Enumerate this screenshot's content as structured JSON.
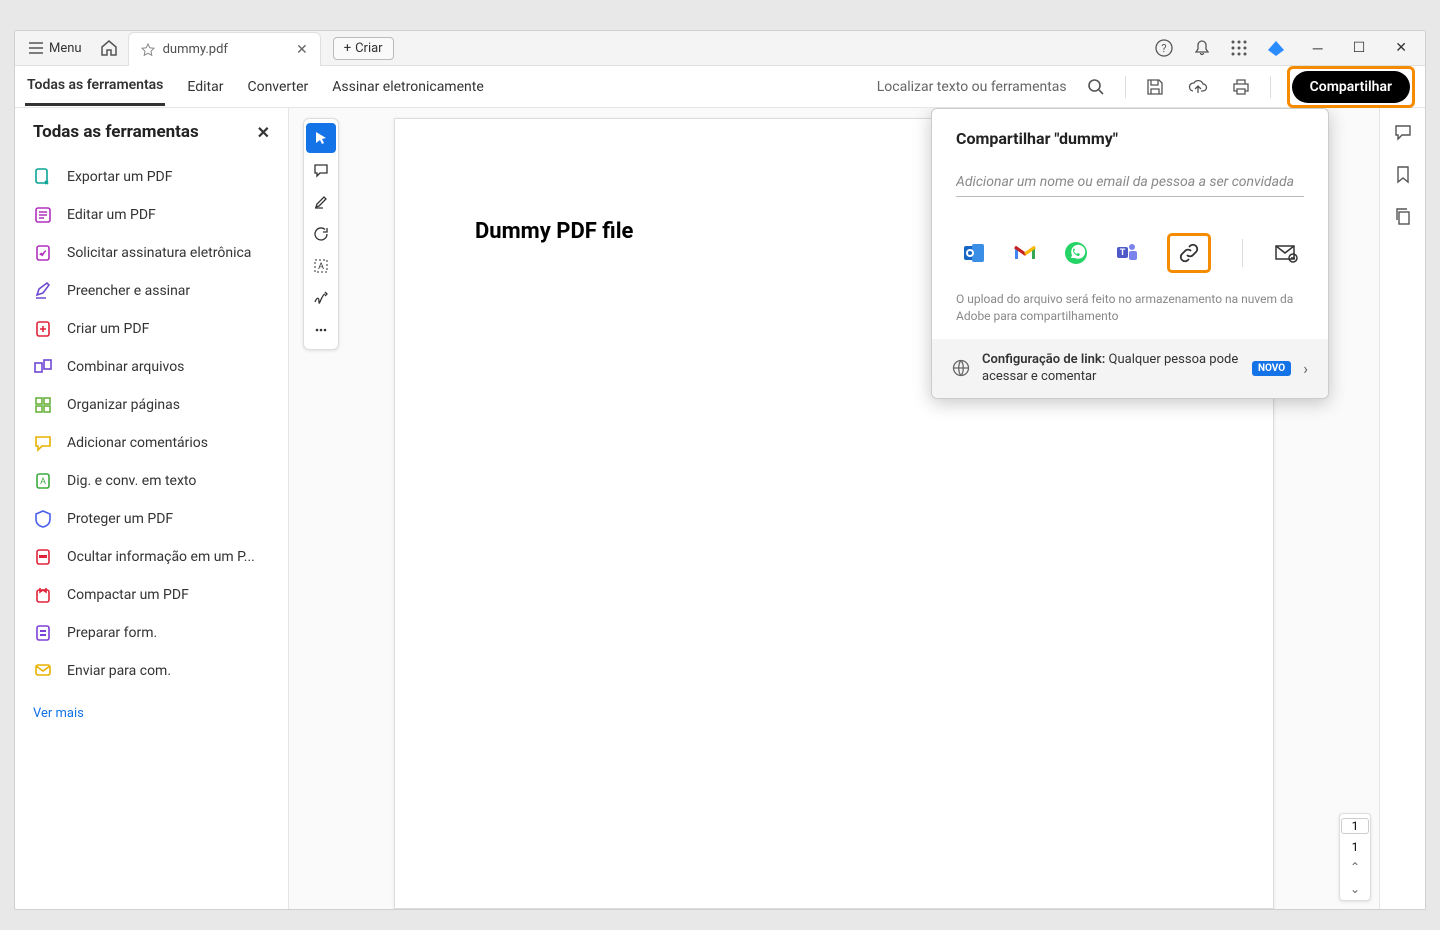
{
  "window": {
    "menu_label": "Menu",
    "tab_name": "dummy.pdf",
    "create_label": "Criar"
  },
  "toolbar": {
    "tabs": [
      "Todas as ferramentas",
      "Editar",
      "Converter",
      "Assinar eletronicamente"
    ],
    "search_label": "Localizar texto ou ferramentas",
    "share_label": "Compartilhar"
  },
  "sidebar": {
    "title": "Todas as ferramentas",
    "items": [
      {
        "label": "Exportar um PDF",
        "color": "#0aa396"
      },
      {
        "label": "Editar um PDF",
        "color": "#b130bd"
      },
      {
        "label": "Solicitar assinatura eletrônica",
        "color": "#b130bd"
      },
      {
        "label": "Preencher e assinar",
        "color": "#6e48d1"
      },
      {
        "label": "Criar um PDF",
        "color": "#e0243a"
      },
      {
        "label": "Combinar arquivos",
        "color": "#6e48d1"
      },
      {
        "label": "Organizar páginas",
        "color": "#6cb33f"
      },
      {
        "label": "Adicionar comentários",
        "color": "#e8b100"
      },
      {
        "label": "Dig. e conv. em texto",
        "color": "#3caa3c"
      },
      {
        "label": "Proteger um PDF",
        "color": "#4a5fea"
      },
      {
        "label": "Ocultar informação em um P...",
        "color": "#e0243a"
      },
      {
        "label": "Compactar um PDF",
        "color": "#e0243a"
      },
      {
        "label": "Preparar form.",
        "color": "#7e3fd8"
      },
      {
        "label": "Enviar para com.",
        "color": "#e8b100"
      }
    ],
    "see_more": "Ver mais"
  },
  "document": {
    "heading": "Dummy PDF file"
  },
  "share_popover": {
    "title": "Compartilhar \"dummy\"",
    "input_placeholder": "Adicionar um nome ou email da pessoa a ser convidada",
    "note": "O upload do arquivo será feito no armazenamento na nuvem da Adobe para compartilhamento",
    "link_config_label": "Configuração de link:",
    "link_config_value": "Qualquer pessoa pode acessar e comentar",
    "novo": "NOVO"
  },
  "page_nav": {
    "current": "1",
    "total": "1"
  }
}
